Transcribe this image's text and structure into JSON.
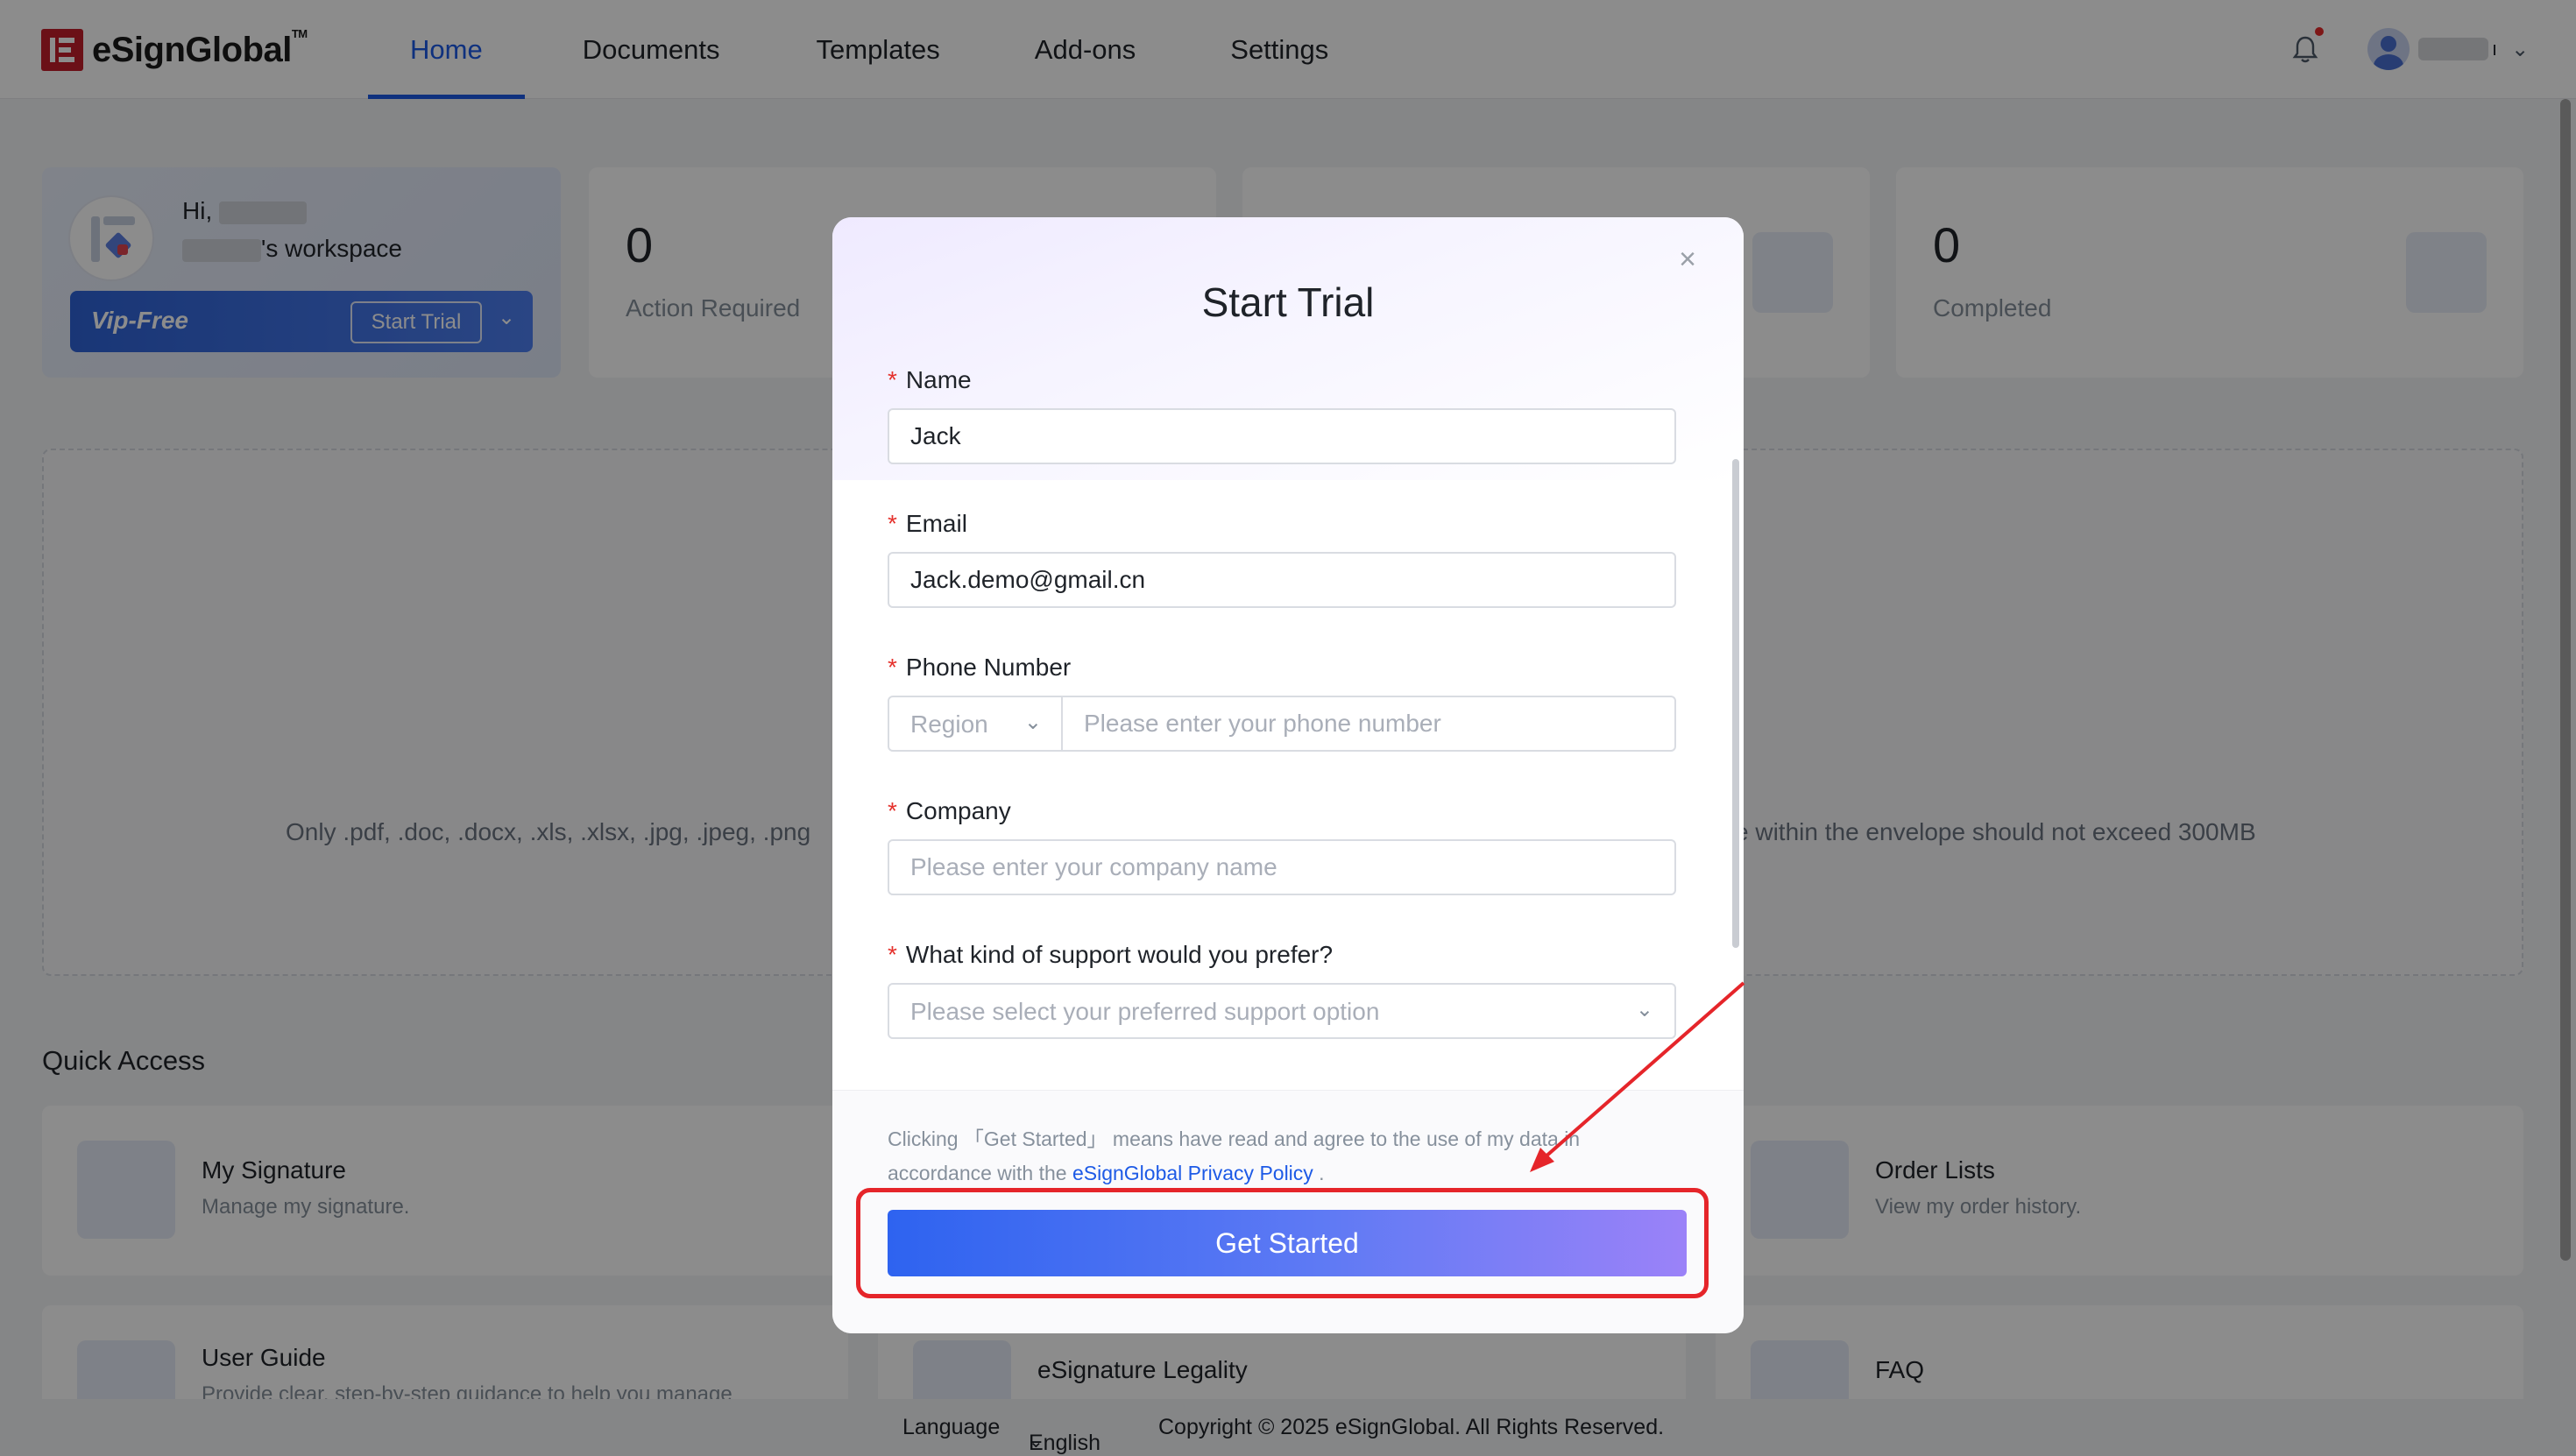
{
  "brand": {
    "name": "eSignGlobal",
    "tm": "TM"
  },
  "nav": {
    "items": [
      "Home",
      "Documents",
      "Templates",
      "Add-ons",
      "Settings"
    ],
    "active": "Home"
  },
  "header": {
    "user_suffix": "ı"
  },
  "workspace": {
    "greeting": "Hi, ",
    "workspace_suffix": "'s workspace",
    "plan": "Vip-Free",
    "start_trial": "Start Trial"
  },
  "stats": [
    {
      "value": "0",
      "label": "Action Required"
    },
    {
      "value": "0",
      "label": "Completed"
    }
  ],
  "upload": {
    "text_left": "Only .pdf, .doc, .docx, .xls, .xlsx, .jpg, .jpeg, .png",
    "text_right": "e within the envelope should not exceed 300MB"
  },
  "quick_access": {
    "title": "Quick Access",
    "items": [
      {
        "name": "My Signature",
        "desc": "Manage my signature."
      },
      {
        "name": "Order Lists",
        "desc": "View my order history."
      },
      {
        "name": "User Guide",
        "desc": "Provide clear, step-by-step guidance to help you manage"
      },
      {
        "name": "eSignature Legality",
        "desc": ""
      },
      {
        "name": "FAQ",
        "desc": ""
      }
    ]
  },
  "footer": {
    "language_label": "Language",
    "language_value": "English",
    "copyright": "Copyright © 2025 eSignGlobal. All Rights Reserved."
  },
  "modal": {
    "title": "Start Trial",
    "fields": {
      "name": {
        "label": "Name",
        "value": "Jack"
      },
      "email": {
        "label": "Email",
        "value": "Jack.demo@gmail.cn"
      },
      "phone": {
        "label": "Phone Number",
        "region_placeholder": "Region",
        "placeholder": "Please enter your phone number"
      },
      "company": {
        "label": "Company",
        "placeholder": "Please enter your company name"
      },
      "support": {
        "label": "What kind of support would you prefer?",
        "placeholder": "Please select your preferred support option"
      }
    },
    "consent_prefix": "Clicking 「Get Started」 means have read and agree to the use of my data in accordance with the ",
    "consent_link": "eSignGlobal Privacy Policy",
    "consent_suffix": " .",
    "submit": "Get Started"
  },
  "colors": {
    "accent": "#1d5ae6",
    "brand_red": "#c41e2a",
    "annotation": "#e5252a"
  }
}
